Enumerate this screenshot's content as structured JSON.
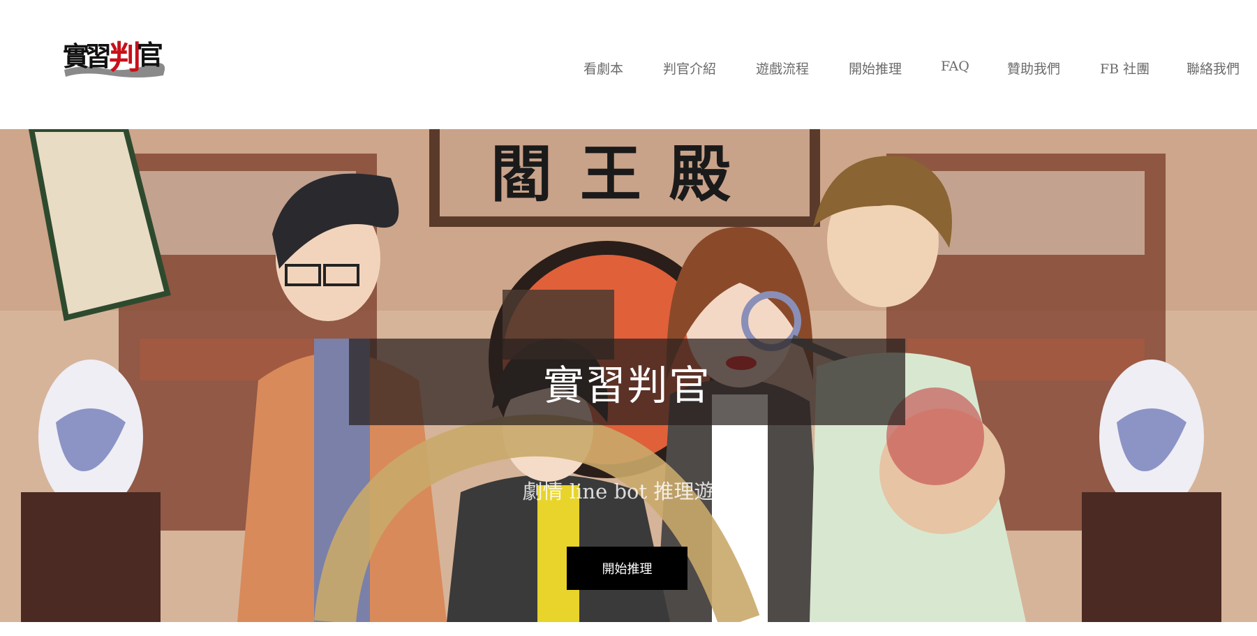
{
  "header": {
    "logo_text": "實習判官",
    "nav": [
      {
        "label": "看劇本"
      },
      {
        "label": "判官介紹"
      },
      {
        "label": "遊戲流程"
      },
      {
        "label": "開始推理"
      },
      {
        "label": "FAQ"
      },
      {
        "label": "贊助我們"
      },
      {
        "label": "FB 社團"
      },
      {
        "label": "聯絡我們"
      }
    ]
  },
  "hero": {
    "plaque_text": "閻王殿",
    "title": "實習判官",
    "subtitle": "劇情 line bot 推理遊戲",
    "cta_label": "開始推理"
  },
  "colors": {
    "nav_text": "#6b6b6b",
    "title_overlay": "rgba(40,32,30,0.72)",
    "cta_bg": "#000000",
    "logo_red": "#c8101a"
  }
}
